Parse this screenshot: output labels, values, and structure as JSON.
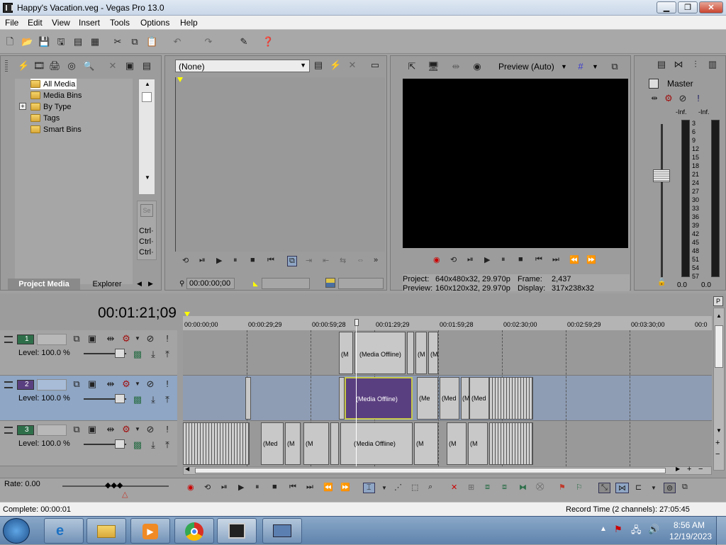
{
  "window": {
    "title": "Happy's Vacation.veg - Vegas Pro 13.0",
    "min_label": "▁",
    "max_label": "❐",
    "close_label": "✕"
  },
  "menu": [
    "File",
    "Edit",
    "View",
    "Insert",
    "Tools",
    "Options",
    "Help"
  ],
  "project_media": {
    "tree": [
      "All Media",
      "Media Bins",
      "By Type",
      "Tags",
      "Smart Bins"
    ],
    "expander": "+",
    "tabs": [
      "Project Media",
      "Explorer"
    ],
    "side_labels": [
      "Ctrl·",
      "Ctrl·",
      "Ctrl·"
    ]
  },
  "trimmer": {
    "dropdown_value": "(None)",
    "timecode": "00:00:00;00"
  },
  "preview": {
    "mode_label": "Preview (Auto)",
    "project_label": "Project:",
    "project_value": "640x480x32, 29.970p",
    "preview_label": "Preview:",
    "preview_value": "160x120x32, 29.970p",
    "frame_label": "Frame:",
    "frame_value": "2,437",
    "display_label": "Display:",
    "display_value": "317x238x32"
  },
  "master": {
    "title": "Master",
    "left_peak": "-Inf.",
    "right_peak": "-Inf.",
    "scale": [
      "3",
      "6",
      "9",
      "12",
      "15",
      "18",
      "21",
      "24",
      "27",
      "30",
      "33",
      "36",
      "39",
      "42",
      "45",
      "48",
      "51",
      "54",
      "57"
    ],
    "left_value": "0.0",
    "right_value": "0.0"
  },
  "timeline": {
    "current_time": "00:01:21;09",
    "ruler": [
      "00:00:00;00",
      "00:00:29;29",
      "00:00:59;28",
      "00:01:29;29",
      "00:01:59;28",
      "00:02:30;00",
      "00:02:59;29",
      "00:03:30;00",
      "00:0"
    ],
    "tracks": [
      {
        "num": "1",
        "level": "Level: 100.0 %"
      },
      {
        "num": "2",
        "level": "Level: 100.0 %"
      },
      {
        "num": "3",
        "level": "Level: 100.0 %"
      }
    ],
    "clip_label": "(Media Offline)",
    "short_label": "(M",
    "short_label2": "(Med",
    "short_label3": "(Me"
  },
  "bottom": {
    "rate": "Rate: 0.00",
    "complete": "Complete: 00:00:01",
    "record_time": "Record Time (2 channels): 27:05:45"
  },
  "taskbar": {
    "time": "8:56 AM",
    "date": "12/19/2023"
  }
}
